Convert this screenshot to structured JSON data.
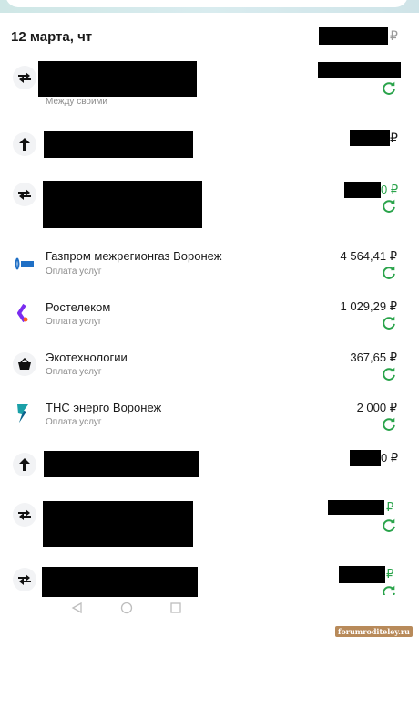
{
  "header": {
    "date": "12 марта, чт",
    "currency": "₽"
  },
  "transactions": [
    {
      "icon": "transfer-icon",
      "subtitle": "Между своими"
    },
    {
      "icon": "arrow-up-icon"
    },
    {
      "icon": "transfer-icon",
      "amount_tail": "0 ₽"
    },
    {
      "icon": "gazprom-logo",
      "title": "Газпром межрегионгаз Воронеж",
      "subtitle": "Оплата услуг",
      "amount": "4 564,41 ₽"
    },
    {
      "icon": "rostelecom-logo",
      "title": "Ростелеком",
      "subtitle": "Оплата услуг",
      "amount": "1 029,29 ₽"
    },
    {
      "icon": "basket-icon",
      "title": "Экотехнологии",
      "subtitle": "Оплата услуг",
      "amount": "367,65 ₽"
    },
    {
      "icon": "tns-logo",
      "title": "ТНС энерго Воронеж",
      "subtitle": "Оплата услуг",
      "amount": "2 000 ₽"
    },
    {
      "icon": "arrow-up-icon",
      "amount_tail": "0 ₽"
    },
    {
      "icon": "transfer-icon",
      "amount_tail": "₽"
    },
    {
      "icon": "transfer-icon",
      "amount_tail": "₽"
    }
  ],
  "colors": {
    "accent_green": "#29a34a",
    "text": "#1a1a1a",
    "muted": "#8c8c8c"
  },
  "watermark": "forumroditeley.ru"
}
